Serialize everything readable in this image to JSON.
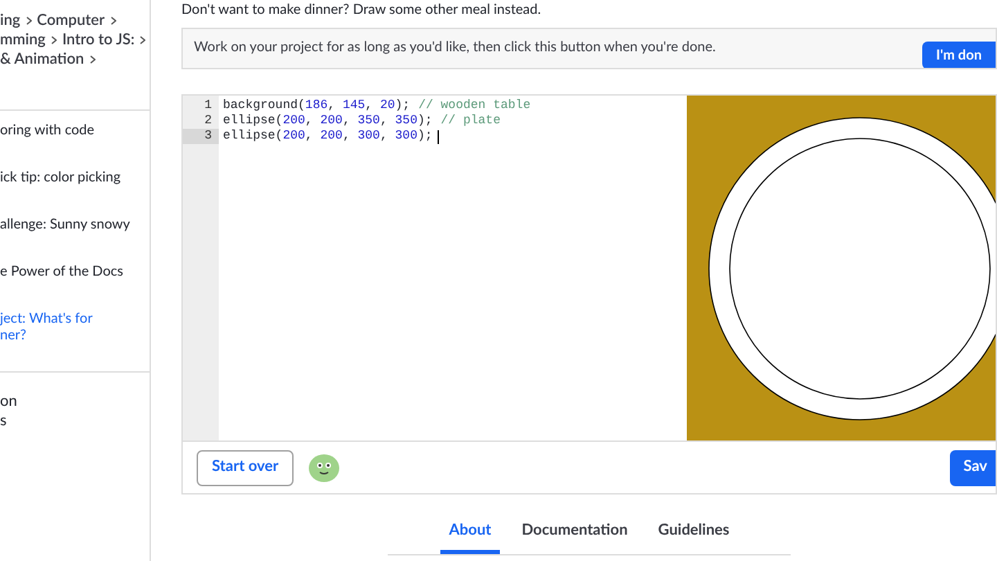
{
  "sidebar": {
    "breadcrumb": [
      "ing",
      "Computer",
      "mming",
      "Intro to JS:",
      "& Animation"
    ],
    "items": [
      {
        "label": "oring with code",
        "selected": false
      },
      {
        "label": "ick tip: color picking",
        "selected": false
      },
      {
        "label": "allenge: Sunny snowy",
        "selected": false
      },
      {
        "label": "e Power of the Docs",
        "selected": false
      },
      {
        "label": "ject: What's for ner?",
        "selected": true
      }
    ],
    "footer_items": [
      "on",
      "s"
    ]
  },
  "intro": "Don't want to make dinner? Draw some other meal instead.",
  "banner": {
    "text": "Work on your project for as long as you'd like, then click this button when you're done.",
    "button": "I'm don"
  },
  "editor": {
    "lines": [
      {
        "number": "1",
        "code": "background(186, 145, 20);",
        "comment": "// wooden table",
        "selected": false
      },
      {
        "number": "2",
        "code": "ellipse(200, 200, 350, 350);",
        "comment": "// plate",
        "selected": false
      },
      {
        "number": "3",
        "code": "ellipse(200, 200, 300, 300);",
        "selected": true
      }
    ]
  },
  "buttons": {
    "start_over": "Start over",
    "save": "Sav"
  },
  "tabs": [
    {
      "label": "About",
      "selected": true
    },
    {
      "label": "Documentation",
      "selected": false
    },
    {
      "label": "Guidelines",
      "selected": false
    }
  ]
}
